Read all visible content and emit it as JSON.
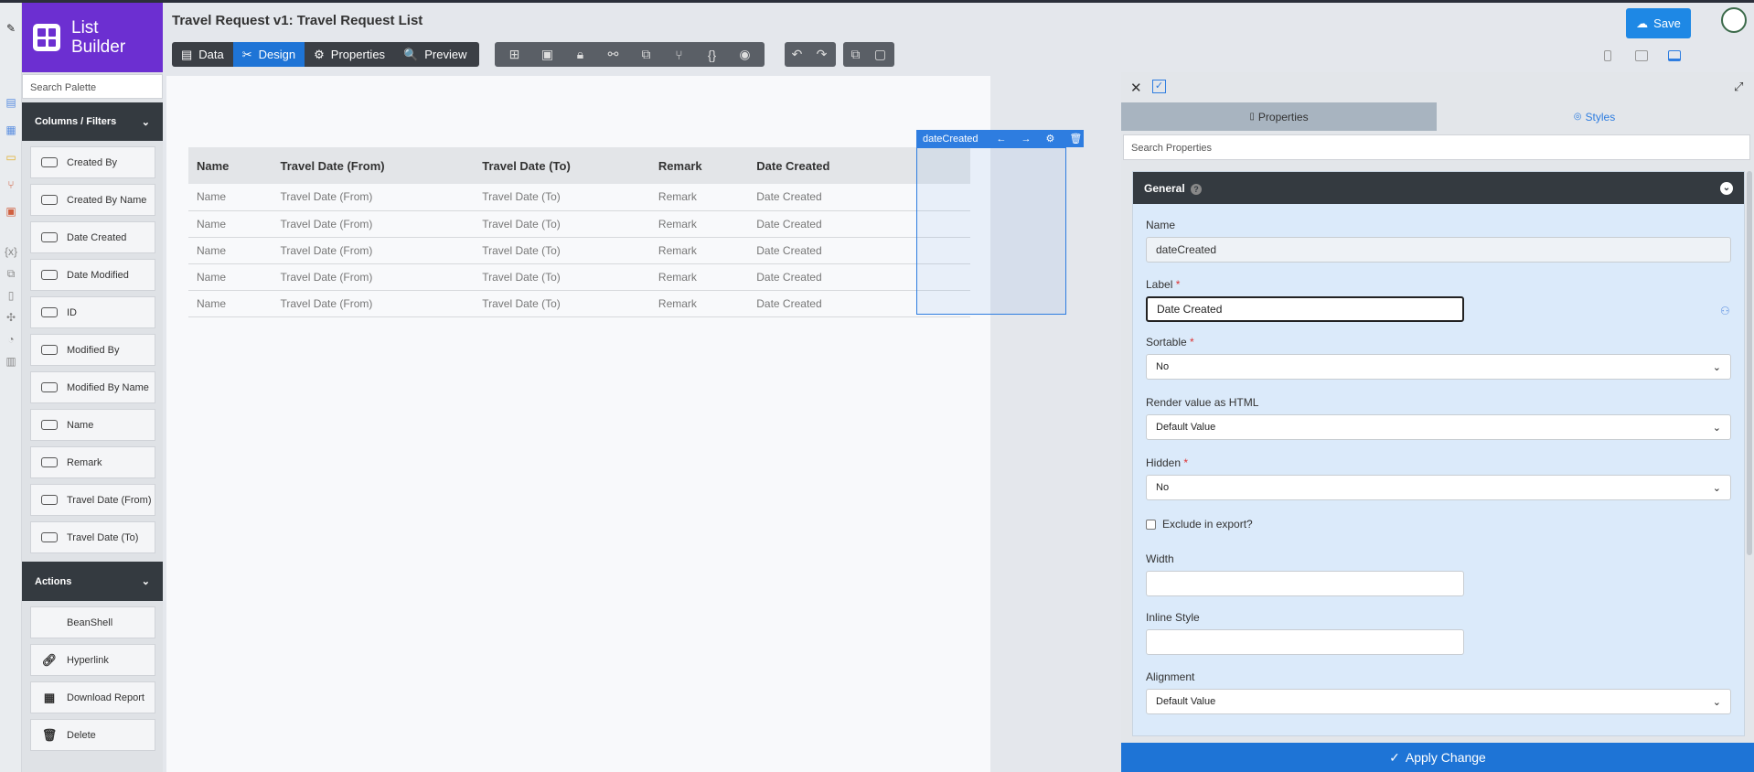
{
  "app": {
    "name_line1": "List",
    "name_line2": "Builder"
  },
  "header": {
    "title": "Travel Request v1: Travel Request List",
    "modes": [
      {
        "icon": "database-icon",
        "label": "Data"
      },
      {
        "icon": "design-icon",
        "label": "Design"
      },
      {
        "icon": "gear-icon",
        "label": "Properties"
      },
      {
        "icon": "preview-icon",
        "label": "Preview"
      }
    ],
    "save_label": "Save"
  },
  "palette": {
    "search_placeholder": "Search Palette",
    "columns_section": "Columns / Filters",
    "columns": [
      "Created By",
      "Created By Name",
      "Date Created",
      "Date Modified",
      "ID",
      "Modified By",
      "Modified By Name",
      "Name",
      "Remark",
      "Travel Date (From)",
      "Travel Date (To)"
    ],
    "actions_section": "Actions",
    "actions": [
      {
        "icon": "code-icon",
        "label": "BeanShell"
      },
      {
        "icon": "link-icon",
        "label": "Hyperlink"
      },
      {
        "icon": "grid-icon",
        "label": "Download Report"
      },
      {
        "icon": "trash-icon",
        "label": "Delete"
      }
    ]
  },
  "canvas": {
    "headers": [
      "Name",
      "Travel Date (From)",
      "Travel Date (To)",
      "Remark",
      "Date Created"
    ],
    "rows": [
      [
        "Name",
        "Travel Date (From)",
        "Travel Date (To)",
        "Remark",
        "Date Created"
      ],
      [
        "Name",
        "Travel Date (From)",
        "Travel Date (To)",
        "Remark",
        "Date Created"
      ],
      [
        "Name",
        "Travel Date (From)",
        "Travel Date (To)",
        "Remark",
        "Date Created"
      ],
      [
        "Name",
        "Travel Date (From)",
        "Travel Date (To)",
        "Remark",
        "Date Created"
      ],
      [
        "Name",
        "Travel Date (From)",
        "Travel Date (To)",
        "Remark",
        "Date Created"
      ]
    ],
    "selected_tag": "dateCreated"
  },
  "properties": {
    "tab_properties": "Properties",
    "tab_styles": "Styles",
    "search_placeholder": "Search Properties",
    "section_general": "General",
    "name_label": "Name",
    "name_value": "dateCreated",
    "label_label": "Label",
    "label_value": "Date Created",
    "sortable_label": "Sortable",
    "sortable_value": "No",
    "render_html_label": "Render value as HTML",
    "render_html_value": "Default Value",
    "hidden_label": "Hidden",
    "hidden_value": "No",
    "exclude_label": "Exclude in export?",
    "width_label": "Width",
    "inline_style_label": "Inline Style",
    "alignment_label": "Alignment",
    "alignment_value": "Default Value",
    "apply_label": "Apply Change"
  },
  "colors": {
    "brand": "#6c2fd1",
    "accent": "#1e74d6",
    "dark": "#343a40"
  }
}
